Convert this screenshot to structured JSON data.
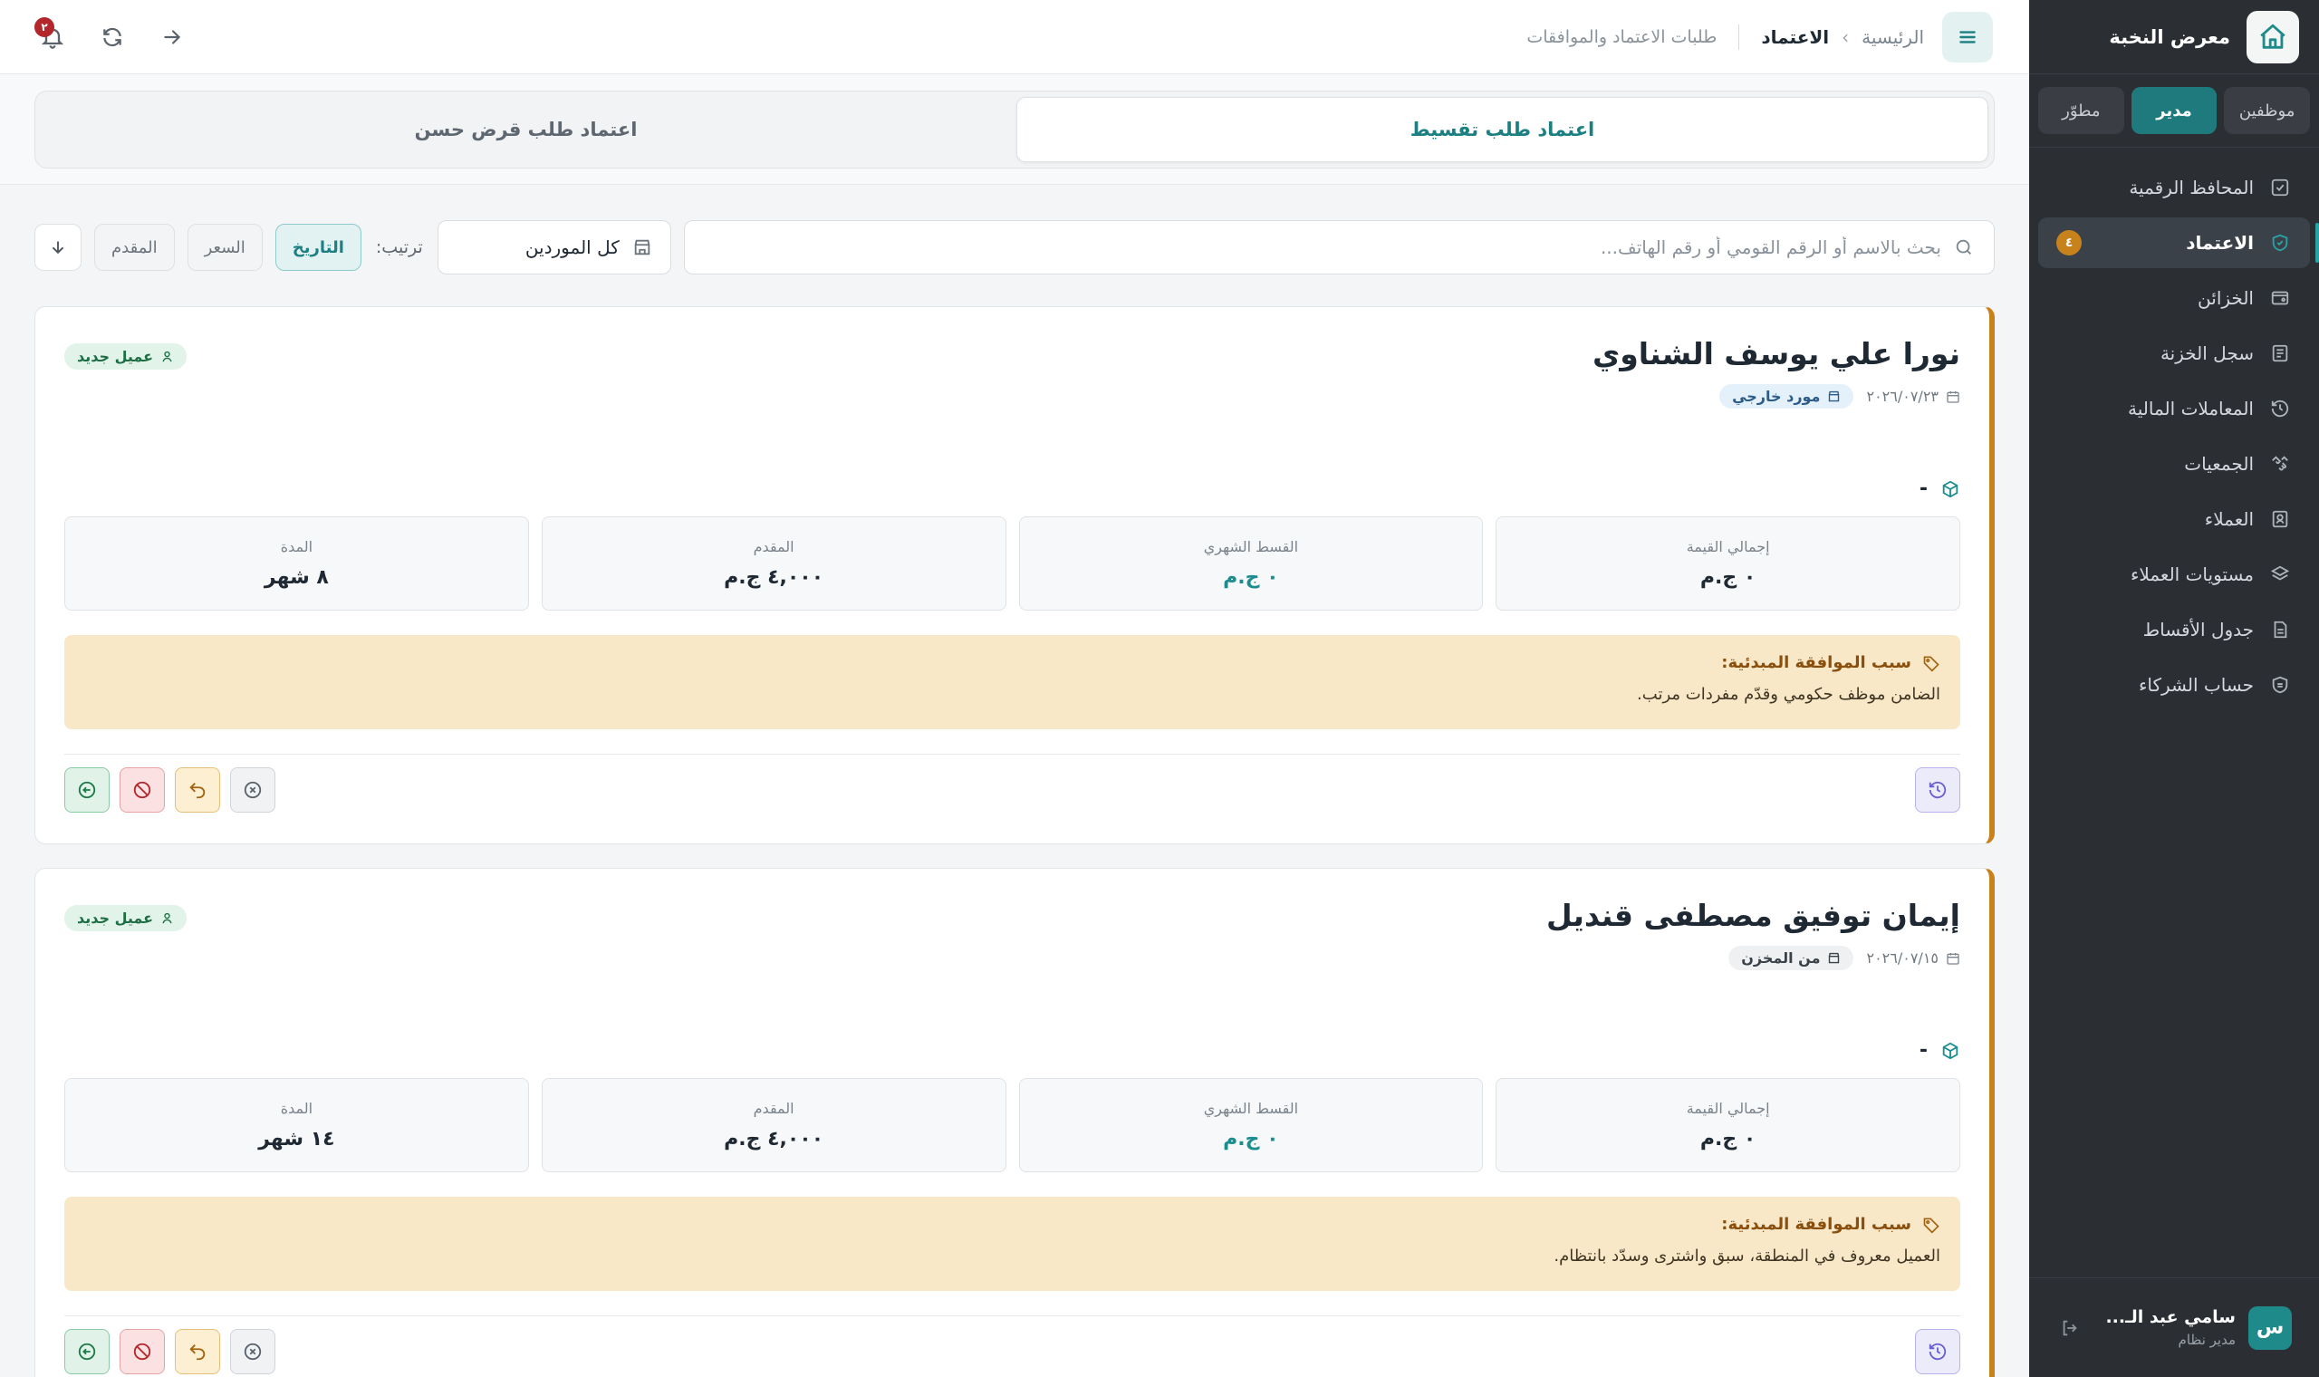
{
  "sidebar": {
    "brand": "معرض النخبة",
    "roles": [
      {
        "label": "موظفين",
        "active": false
      },
      {
        "label": "مدير",
        "active": true
      },
      {
        "label": "مطوّر",
        "active": false
      }
    ],
    "nav": [
      {
        "label": "المحافظ الرقمية",
        "icon": "wallet-check-icon"
      },
      {
        "label": "الاعتماد",
        "icon": "shield-check-icon",
        "active": true,
        "badge": "٤"
      },
      {
        "label": "الخزائن",
        "icon": "safe-icon"
      },
      {
        "label": "سجل الخزنة",
        "icon": "ledger-icon"
      },
      {
        "label": "المعاملات المالية",
        "icon": "history-icon"
      },
      {
        "label": "الجمعيات",
        "icon": "handshake-icon"
      },
      {
        "label": "العملاء",
        "icon": "contact-card-icon"
      },
      {
        "label": "مستويات العملاء",
        "icon": "layers-icon"
      },
      {
        "label": "جدول الأقساط",
        "icon": "document-icon"
      },
      {
        "label": "حساب الشركاء",
        "icon": "partners-icon"
      }
    ],
    "user": {
      "initial": "س",
      "name": "سامي عبد الـ...",
      "role": "مدير نظام"
    }
  },
  "topbar": {
    "breadcrumb_home": "الرئيسية",
    "breadcrumb_separator": "›",
    "breadcrumb_current": "الاعتماد",
    "subtitle": "طلبات الاعتماد والموافقات",
    "notification_count": "٢"
  },
  "tabs": [
    {
      "label": "اعتماد طلب تقسيط",
      "active": true
    },
    {
      "label": "اعتماد طلب قرض حسن",
      "active": false
    }
  ],
  "filters": {
    "search_placeholder": "بحث بالاسم أو الرقم القومي أو رقم الهاتف...",
    "supplier_value": "كل الموردين",
    "sort_label": "ترتيب:",
    "sort_options": [
      {
        "label": "التاريخ",
        "active": true
      },
      {
        "label": "السعر",
        "active": false
      },
      {
        "label": "المقدم",
        "active": false
      }
    ]
  },
  "cards": [
    {
      "name": "نورا علي يوسف الشناوي",
      "date": "٢٠٢٦/٠٧/٢٣",
      "source": "مورد خارجي",
      "source_type": "external",
      "customer_badge": "عميل جديد",
      "product": "-",
      "stats": [
        {
          "label": "إجمالي القيمة",
          "value": "٠ ج.م"
        },
        {
          "label": "القسط الشهري",
          "value": "٠ ج.م"
        },
        {
          "label": "المقدم",
          "value": "٤,٠٠٠ ج.م"
        },
        {
          "label": "المدة",
          "value": "٨ شهر"
        }
      ],
      "reason_title": "سبب الموافقة المبدئية:",
      "reason_text": "الضامن موظف حكومي وقدّم مفردات مرتب."
    },
    {
      "name": "إيمان توفيق مصطفى قنديل",
      "date": "٢٠٢٦/٠٧/١٥",
      "source": "من المخزن",
      "source_type": "store",
      "customer_badge": "عميل جديد",
      "product": "-",
      "stats": [
        {
          "label": "إجمالي القيمة",
          "value": "٠ ج.م"
        },
        {
          "label": "القسط الشهري",
          "value": "٠ ج.م"
        },
        {
          "label": "المقدم",
          "value": "٤,٠٠٠ ج.م"
        },
        {
          "label": "المدة",
          "value": "١٤ شهر"
        }
      ],
      "reason_title": "سبب الموافقة المبدئية:",
      "reason_text": "العميل معروف في المنطقة، سبق واشترى وسدّد بانتظام."
    }
  ],
  "colors": {
    "accent": "#1f7a7e",
    "warning_border": "#c8821c",
    "sidebar_bg": "#2b2e33"
  }
}
